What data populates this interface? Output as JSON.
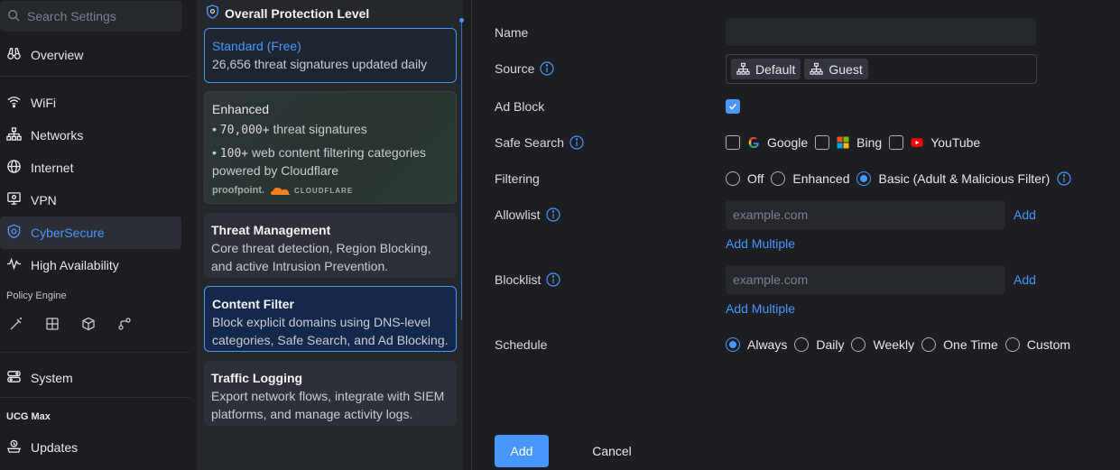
{
  "sidebar": {
    "search_placeholder": "Search Settings",
    "items": {
      "overview": "Overview",
      "wifi": "WiFi",
      "networks": "Networks",
      "internet": "Internet",
      "vpn": "VPN",
      "cybersecure": "CyberSecure",
      "high_availability": "High Availability",
      "system": "System",
      "updates": "Updates"
    },
    "policy_engine_label": "Policy Engine",
    "device_label": "UCG Max",
    "accent": "#4797ff"
  },
  "protection": {
    "header": "Overall Protection Level",
    "standard": {
      "title": "Standard (Free)",
      "desc": "26,656 threat signatures updated daily"
    },
    "enhanced": {
      "title": "Enhanced",
      "bullet1_num": "70,000+",
      "bullet1_text": "threat signatures",
      "bullet2_num": "100+",
      "bullet2_text": "web content filtering categories",
      "powered": "powered by Cloudflare",
      "logo_proofpoint": "proofpoint.",
      "logo_cloudflare": "CLOUDFLARE"
    },
    "threat_management": {
      "title": "Threat Management",
      "desc": "Core threat detection, Region Blocking, and active Intrusion Prevention."
    },
    "content_filter": {
      "title": "Content Filter",
      "desc": "Block explicit domains using DNS-level categories, Safe Search, and Ad Blocking."
    },
    "traffic_logging": {
      "title": "Traffic Logging",
      "desc": "Export network flows, integrate with SIEM platforms, and manage activity logs."
    }
  },
  "form": {
    "name_label": "Name",
    "name_value": "",
    "source_label": "Source",
    "source_chips": [
      "Default",
      "Guest"
    ],
    "adblock_label": "Ad Block",
    "adblock_checked": true,
    "safesearch_label": "Safe Search",
    "safesearch_options": {
      "google": "Google",
      "bing": "Bing",
      "youtube": "YouTube"
    },
    "filtering_label": "Filtering",
    "filtering_options": {
      "off": "Off",
      "enhanced": "Enhanced",
      "basic": "Basic (Adult & Malicious Filter)"
    },
    "filtering_selected": "basic",
    "allowlist_label": "Allowlist",
    "allowlist_placeholder": "example.com",
    "blocklist_label": "Blocklist",
    "blocklist_placeholder": "example.com",
    "add_link": "Add",
    "add_multiple_link": "Add Multiple",
    "schedule_label": "Schedule",
    "schedule_options": {
      "always": "Always",
      "daily": "Daily",
      "weekly": "Weekly",
      "one_time": "One Time",
      "custom": "Custom"
    },
    "schedule_selected": "always",
    "add_button": "Add",
    "cancel_button": "Cancel"
  }
}
